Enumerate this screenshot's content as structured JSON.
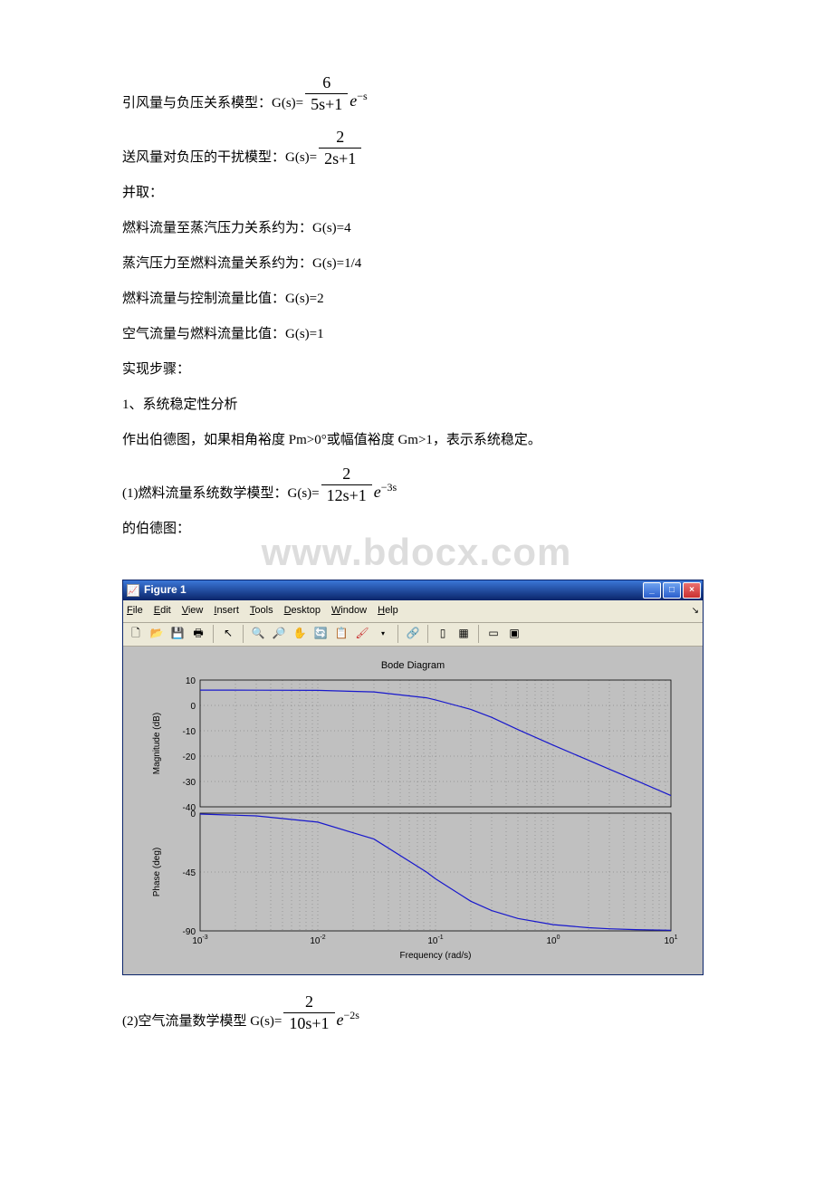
{
  "lines": {
    "l1_pre": "引风量与负压关系模型：G(s)=",
    "l1_num": "6",
    "l1_den": "5s+1",
    "l1_exp": "e",
    "l1_sup": "−s",
    "l2_pre": "送风量对负压的干扰模型：G(s)=",
    "l2_num": "2",
    "l2_den": "2s+1",
    "l3": "并取：",
    "l4": "燃料流量至蒸汽压力关系约为：G(s)=4",
    "l5": "蒸汽压力至燃料流量关系约为：G(s)=1/4",
    "l6": "燃料流量与控制流量比值：G(s)=2",
    "l7": "空气流量与燃料流量比值：G(s)=1",
    "l8": "实现步骤：",
    "l9": "1、系统稳定性分析",
    "l10": "作出伯德图，如果相角裕度 Pm>0°或幅值裕度 Gm>1，表示系统稳定。",
    "l11_pre": "(1)燃料流量系统数学模型：G(s)=",
    "l11_num": "2",
    "l11_den": "12s+1",
    "l11_exp": "e",
    "l11_sup": "−3s",
    "l12": "的伯德图：",
    "l13_pre": "(2)空气流量数学模型 G(s)=",
    "l13_num": "2",
    "l13_den": "10s+1",
    "l13_exp": "e",
    "l13_sup": "−2s"
  },
  "watermark": "www.bdocx.com",
  "figure": {
    "title": "Figure 1",
    "menu": {
      "file": "File",
      "edit": "Edit",
      "view": "View",
      "insert": "Insert",
      "tools": "Tools",
      "desktop": "Desktop",
      "window": "Window",
      "help": "Help"
    },
    "plot_title": "Bode Diagram",
    "xlabel": "Frequency (rad/s)",
    "ylabel_mag": "Magnitude (dB)",
    "ylabel_phase": "Phase (deg)"
  },
  "chart_data": [
    {
      "type": "line",
      "title": "Bode Diagram",
      "xlabel": "Frequency (rad/s)",
      "ylabel": "Magnitude (dB)",
      "xlim": [
        0.001,
        10
      ],
      "ylim": [
        -40,
        10
      ],
      "xscale": "log",
      "xticks": [
        0.001,
        0.01,
        0.1,
        1,
        10
      ],
      "yticks": [
        -40,
        -30,
        -20,
        -10,
        0,
        10
      ],
      "series": [
        {
          "name": "Magnitude",
          "color": "#0000cc",
          "x": [
            0.001,
            0.003,
            0.01,
            0.03,
            0.083,
            0.1,
            0.2,
            0.3,
            0.5,
            1,
            2,
            3,
            5,
            10
          ],
          "values": [
            6.02,
            6.01,
            5.94,
            5.33,
            3.01,
            2.19,
            -1.58,
            -4.7,
            -9.54,
            -15.68,
            -21.63,
            -25.13,
            -29.55,
            -35.57
          ]
        }
      ]
    },
    {
      "type": "line",
      "xlabel": "Frequency (rad/s)",
      "ylabel": "Phase (deg)",
      "xlim": [
        0.001,
        10
      ],
      "ylim": [
        -90,
        0
      ],
      "xscale": "log",
      "xticks": [
        0.001,
        0.01,
        0.1,
        1,
        10
      ],
      "yticks": [
        -90,
        -45,
        0
      ],
      "series": [
        {
          "name": "Phase",
          "color": "#0000cc",
          "x": [
            0.001,
            0.003,
            0.01,
            0.03,
            0.083,
            0.1,
            0.2,
            0.3,
            0.5,
            1,
            2,
            3,
            5,
            10
          ],
          "values": [
            -0.69,
            -2.06,
            -6.84,
            -19.8,
            -45.0,
            -50.19,
            -67.38,
            -74.48,
            -80.54,
            -85.24,
            -87.61,
            -88.41,
            -89.05,
            -89.52
          ]
        }
      ]
    }
  ]
}
